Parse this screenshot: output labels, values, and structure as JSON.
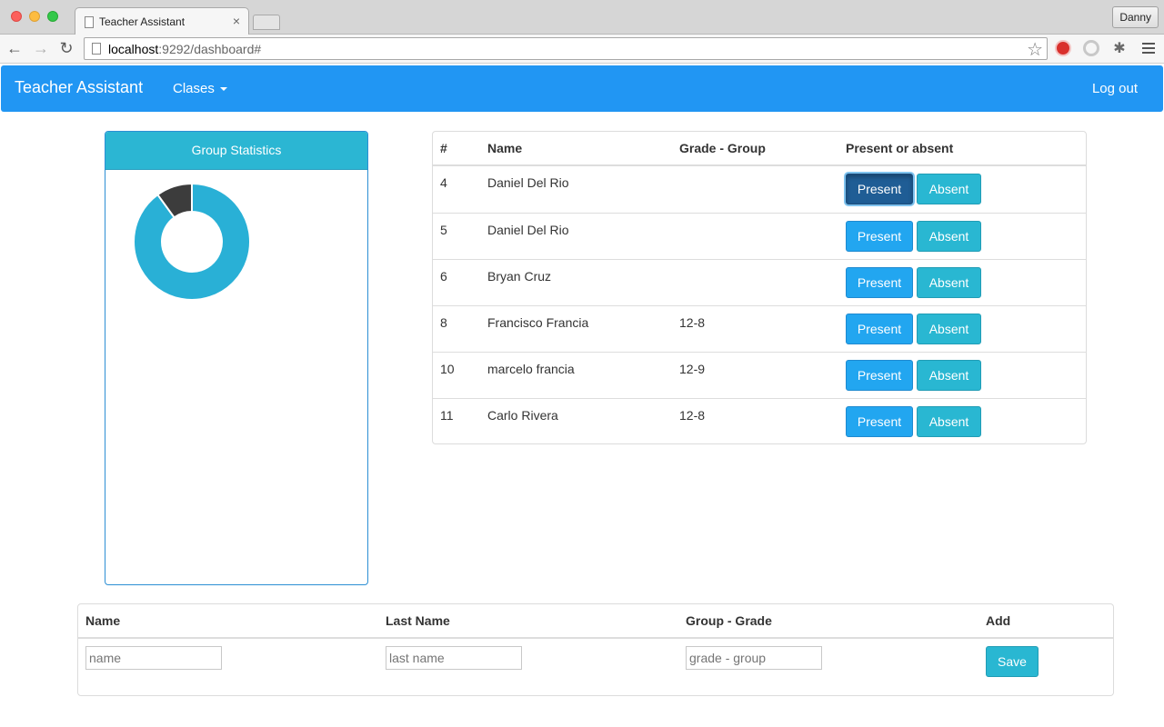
{
  "browser": {
    "tab_title": "Teacher Assistant",
    "tab_close": "×",
    "profile_name": "Danny",
    "url_host": "localhost",
    "url_path": ":9292/dashboard#",
    "back": "←",
    "forward": "→",
    "reload": "↻",
    "star": "☆",
    "puzzle": "✱"
  },
  "navbar": {
    "brand": "Teacher Assistant",
    "clases": "Clases",
    "logout": "Log out",
    "color": "#2196f3"
  },
  "stats": {
    "heading": "Group Statistics",
    "chart_data": {
      "type": "pie",
      "donut": true,
      "slices": [
        {
          "label": "",
          "value": 0.9,
          "color": "#29b0d6"
        },
        {
          "label": "",
          "value": 0.1,
          "color": "#3c3c3c"
        }
      ]
    }
  },
  "attendance": {
    "headers": {
      "id": "#",
      "name": "Name",
      "grade": "Grade - Group",
      "status": "Present or absent"
    },
    "present_label": "Present",
    "absent_label": "Absent",
    "rows": [
      {
        "id": "4",
        "name": "Daniel Del Rio",
        "grade": "",
        "active": true
      },
      {
        "id": "5",
        "name": "Daniel Del Rio",
        "grade": "",
        "active": false
      },
      {
        "id": "6",
        "name": "Bryan Cruz",
        "grade": "",
        "active": false
      },
      {
        "id": "8",
        "name": "Francisco Francia",
        "grade": "12-8",
        "active": false
      },
      {
        "id": "10",
        "name": "marcelo francia",
        "grade": "12-9",
        "active": false
      },
      {
        "id": "11",
        "name": "Carlo Rivera",
        "grade": "12-8",
        "active": false
      }
    ]
  },
  "add_form": {
    "headers": {
      "name": "Name",
      "last_name": "Last Name",
      "group": "Group - Grade",
      "add": "Add"
    },
    "placeholders": {
      "name": "name",
      "last_name": "last name",
      "group": "grade - group"
    },
    "save": "Save"
  }
}
